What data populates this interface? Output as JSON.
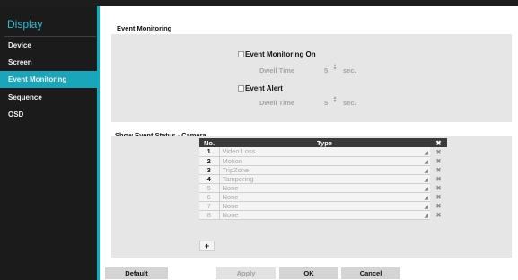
{
  "sidebar": {
    "title": "Display",
    "items": [
      {
        "label": "Device",
        "active": false
      },
      {
        "label": "Screen",
        "active": false
      },
      {
        "label": "Event Monitoring",
        "active": true
      },
      {
        "label": "Sequence",
        "active": false
      },
      {
        "label": "OSD",
        "active": false
      }
    ]
  },
  "event_monitoring": {
    "section_title": "Event Monitoring",
    "monitoring_on": {
      "label": "Event Monitoring On",
      "checked": false
    },
    "dwell_time_1": {
      "label": "Dwell Time",
      "value": "5",
      "unit": "sec."
    },
    "event_alert": {
      "label": "Event Alert",
      "checked": false
    },
    "dwell_time_2": {
      "label": "Dwell Time",
      "value": "5",
      "unit": "sec."
    }
  },
  "event_status": {
    "section_title": "Show Event Status - Camera",
    "columns": {
      "no": "No.",
      "type": "Type",
      "delete": "✖"
    },
    "rows": [
      {
        "no": "1",
        "type": "Video Loss",
        "enabled": true
      },
      {
        "no": "2",
        "type": "Motion",
        "enabled": true
      },
      {
        "no": "3",
        "type": "TripZone",
        "enabled": true
      },
      {
        "no": "4",
        "type": "Tampering",
        "enabled": true
      },
      {
        "no": "5",
        "type": "None",
        "enabled": false
      },
      {
        "no": "6",
        "type": "None",
        "enabled": false
      },
      {
        "no": "7",
        "type": "None",
        "enabled": false
      },
      {
        "no": "8",
        "type": "None",
        "enabled": false
      }
    ],
    "add_label": "+",
    "delete_icon": "✖"
  },
  "buttons": {
    "default": "Default",
    "apply": "Apply",
    "ok": "OK",
    "cancel": "Cancel"
  },
  "colors": {
    "accent": "#1aa6ba",
    "sidebar_bg": "#1b1b1b",
    "panel_bg": "#e6e6e6"
  },
  "icons": {
    "checkbox": "checkbox-icon",
    "spinner": "spinner-arrows-icon",
    "dropdown": "dropdown-caret-icon",
    "delete": "delete-x-icon"
  }
}
